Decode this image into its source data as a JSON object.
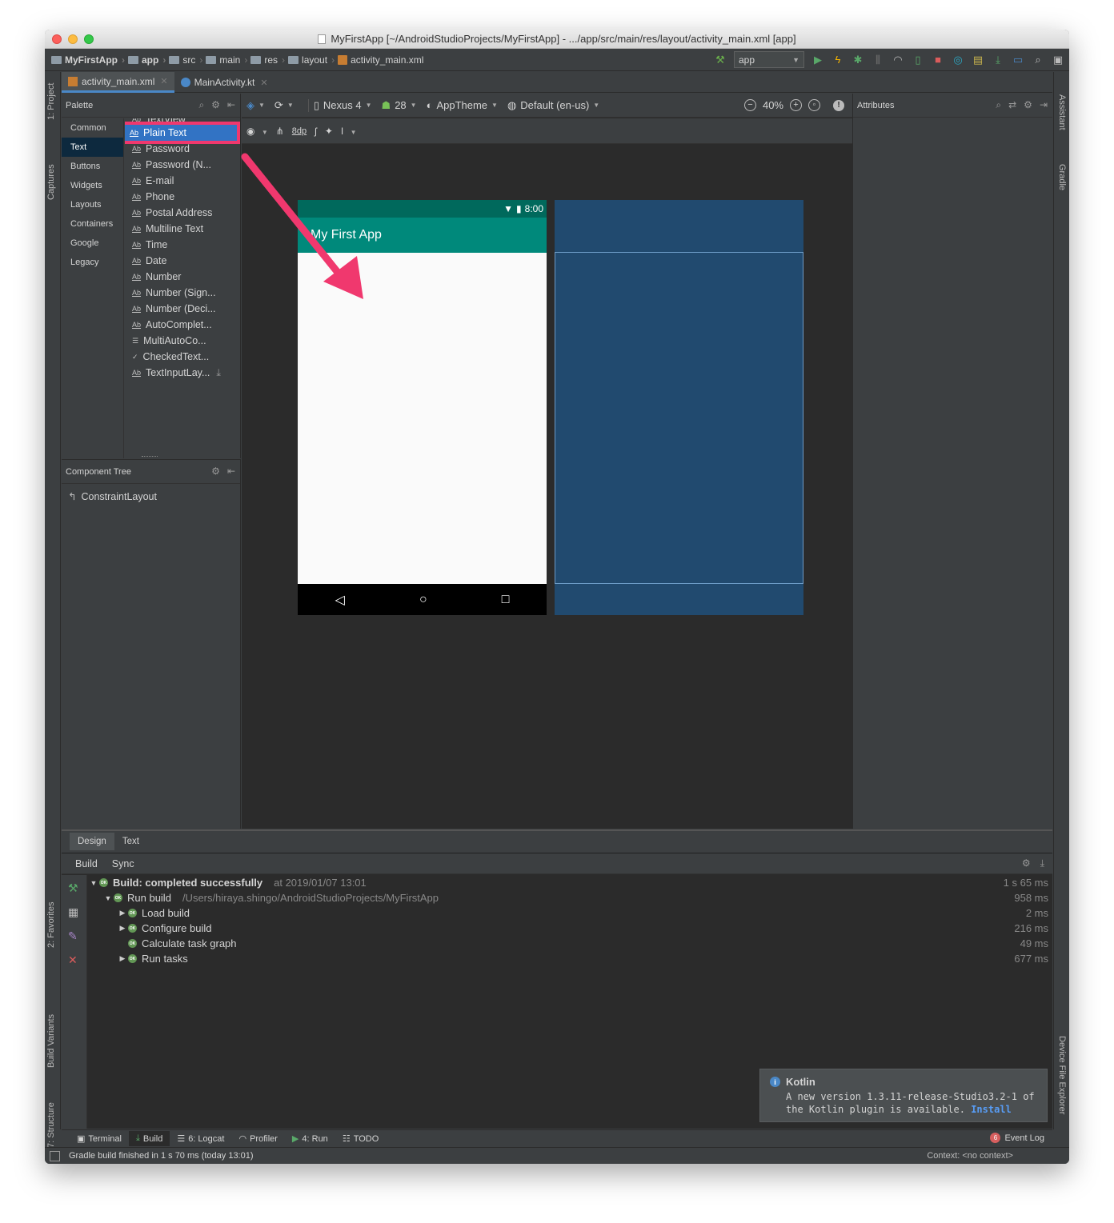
{
  "window": {
    "title": "MyFirstApp [~/AndroidStudioProjects/MyFirstApp] - .../app/src/main/res/layout/activity_main.xml [app]"
  },
  "breadcrumbs": [
    {
      "label": "MyFirstApp"
    },
    {
      "label": "app"
    },
    {
      "label": "src"
    },
    {
      "label": "main"
    },
    {
      "label": "res"
    },
    {
      "label": "layout"
    },
    {
      "label": "activity_main.xml"
    }
  ],
  "run_config": {
    "label": "app"
  },
  "side_tabs": {
    "project": "1: Project",
    "captures": "Captures",
    "favorites": "2: Favorites",
    "build_variants": "Build Variants",
    "structure": "7: Structure",
    "assistant": "Assistant",
    "gradle": "Gradle",
    "device_file_explorer": "Device File Explorer"
  },
  "editor_tabs": [
    {
      "label": "activity_main.xml",
      "active": true
    },
    {
      "label": "MainActivity.kt",
      "active": false
    }
  ],
  "palette": {
    "title": "Palette",
    "categories": [
      "Common",
      "Text",
      "Buttons",
      "Widgets",
      "Layouts",
      "Containers",
      "Google",
      "Legacy"
    ],
    "active_category": "Text",
    "widgets": [
      "TextView",
      "Plain Text",
      "Password",
      "Password (N...",
      "E-mail",
      "Phone",
      "Postal Address",
      "Multiline Text",
      "Time",
      "Date",
      "Number",
      "Number (Sign...",
      "Number (Deci...",
      "AutoComplet...",
      "MultiAutoCo...",
      "CheckedText...",
      "TextInputLay..."
    ],
    "widget_icon_text": "Ab",
    "selected_widget": "Plain Text"
  },
  "component_tree": {
    "title": "Component Tree",
    "items": [
      "ConstraintLayout"
    ]
  },
  "design_toolbar": {
    "device": "Nexus 4",
    "api": "28",
    "theme": "AppTheme",
    "locale": "Default (en-us)",
    "zoom": "40%",
    "margin": "8dp"
  },
  "phone_preview": {
    "time": "8:00",
    "app_title": "My First App",
    "nav_back": "◁",
    "nav_home": "○",
    "nav_recent": "□"
  },
  "attributes": {
    "title": "Attributes"
  },
  "design_tabs": [
    {
      "label": "Design",
      "active": true
    },
    {
      "label": "Text",
      "active": false
    }
  ],
  "build_panel": {
    "tabs": [
      "Build",
      "Sync"
    ],
    "rows": [
      {
        "label": "Build: completed successfully",
        "detail": "at 2019/01/07 13:01",
        "time": "1 s 65 ms",
        "indent": 0,
        "arrow": "▼"
      },
      {
        "label": "Run build",
        "detail": "/Users/hiraya.shingo/AndroidStudioProjects/MyFirstApp",
        "time": "958 ms",
        "indent": 1,
        "arrow": "▼"
      },
      {
        "label": "Load build",
        "detail": "",
        "time": "2 ms",
        "indent": 2,
        "arrow": "▶"
      },
      {
        "label": "Configure build",
        "detail": "",
        "time": "216 ms",
        "indent": 2,
        "arrow": "▶"
      },
      {
        "label": "Calculate task graph",
        "detail": "",
        "time": "49 ms",
        "indent": 2,
        "arrow": ""
      },
      {
        "label": "Run tasks",
        "detail": "",
        "time": "677 ms",
        "indent": 2,
        "arrow": "▶"
      }
    ],
    "ok_badge": "OK"
  },
  "notification": {
    "title": "Kotlin",
    "body_line1": "A new version 1.3.11-release-Studio3.2-1 of",
    "body_line2": "the Kotlin plugin is available.",
    "link": "Install"
  },
  "bottom_tools": [
    {
      "label": "Terminal",
      "icon": "terminal-icon",
      "active": false
    },
    {
      "label": "Build",
      "icon": "build-icon",
      "active": true
    },
    {
      "label": "6: Logcat",
      "icon": "logcat-icon",
      "active": false
    },
    {
      "label": "Profiler",
      "icon": "profiler-icon",
      "active": false
    },
    {
      "label": "4: Run",
      "icon": "run-icon",
      "active": false
    },
    {
      "label": "TODO",
      "icon": "todo-icon",
      "active": false
    }
  ],
  "event_log": {
    "label": "Event Log",
    "count": "6"
  },
  "status": {
    "message": "Gradle build finished in 1 s 70 ms (today 13:01)",
    "context": "Context: <no context>"
  },
  "colors": {
    "accent": "#4a88c7",
    "highlight": "#f0386e",
    "app_bar": "#00897b",
    "status_bar": "#00695c",
    "blueprint": "#214a6f"
  }
}
